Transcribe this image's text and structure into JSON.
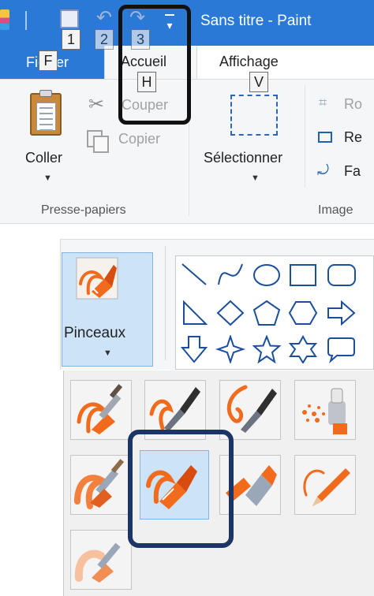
{
  "window": {
    "title": "Sans titre - Paint",
    "quick_access_keytips": [
      "1",
      "2",
      "3"
    ]
  },
  "tabs": [
    {
      "label": "Fichier",
      "keytip": "F"
    },
    {
      "label": "Accueil",
      "keytip": "H"
    },
    {
      "label": "Affichage",
      "keytip": "V"
    }
  ],
  "clipboard_group": {
    "paste_label": "Coller",
    "cut_label": "Couper",
    "copy_label": "Copier",
    "group_label": "Presse-papiers"
  },
  "image_group": {
    "select_label": "Sélectionner",
    "crop_label": "Ro",
    "resize_label": "Re",
    "rotate_label": "Fa",
    "group_label": "Image"
  },
  "brushes": {
    "button_label": "Pinceaux",
    "tiles": [
      "pinceau",
      "pinceau calligraphique 1",
      "pinceau calligraphique 2",
      "aérographe",
      "pinceau à l'huile",
      "crayon",
      "marqueur",
      "pinceau aquarelle",
      "pinceau naturel"
    ]
  },
  "icons": {
    "paste": "clipboard-icon",
    "cut": "scissors-icon",
    "copy": "copy-icon",
    "select": "selection-rectangle-icon",
    "crop": "crop-icon",
    "resize": "resize-icon",
    "rotate": "rotate-icon"
  },
  "colors": {
    "accent": "#2b79d6",
    "selected_tile": "#cde3f7",
    "brush_orange": "#f26b1d",
    "annotation_outline": "#111111",
    "annotation_outline_blue": "#1d3566"
  }
}
